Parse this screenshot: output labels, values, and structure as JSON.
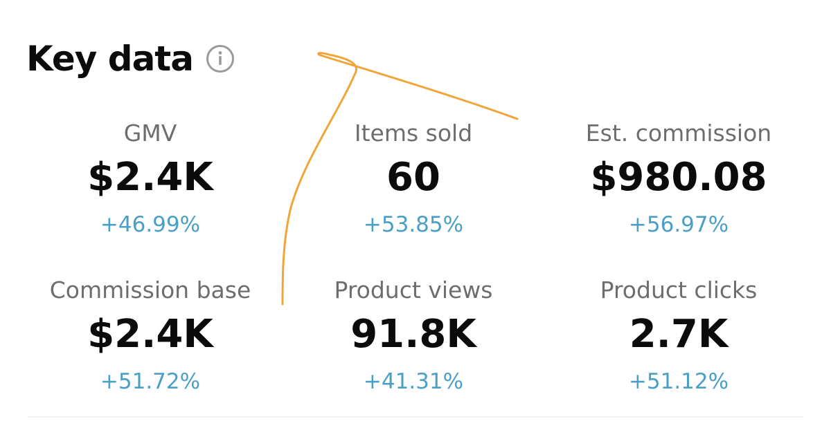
{
  "header": {
    "title": "Key data",
    "info_icon": "info-circle-icon"
  },
  "metrics": [
    {
      "label": "GMV",
      "value": "$2.4K",
      "change": "+46.99%"
    },
    {
      "label": "Items sold",
      "value": "60",
      "change": "+53.85%"
    },
    {
      "label": "Est. commission",
      "value": "$980.08",
      "change": "+56.97%"
    },
    {
      "label": "Commission base",
      "value": "$2.4K",
      "change": "+51.72%"
    },
    {
      "label": "Product views",
      "value": "91.8K",
      "change": "+41.31%"
    },
    {
      "label": "Product clicks",
      "value": "2.7K",
      "change": "+51.12%"
    }
  ],
  "colors": {
    "positive_change": "#4a9fc6",
    "label": "#6d6d6d",
    "value": "#0b0b0b",
    "annotation_stroke": "#f0a53a"
  }
}
